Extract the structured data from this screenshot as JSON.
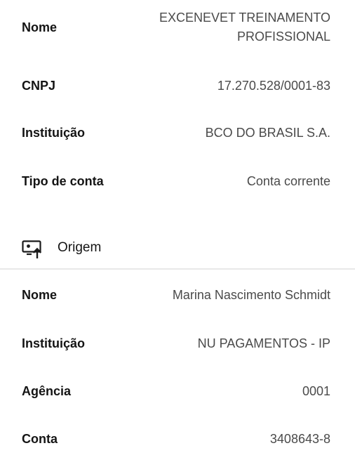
{
  "destino": {
    "rows": [
      {
        "label": "Nome",
        "value": "EXCENEVET TREINAMENTO\nPROFISSIONAL"
      },
      {
        "label": "CNPJ",
        "value": "17.270.528/0001-83"
      },
      {
        "label": "Instituição",
        "value": "BCO DO BRASIL S.A."
      },
      {
        "label": "Tipo de conta",
        "value": "Conta corrente"
      }
    ]
  },
  "origem": {
    "title": "Origem",
    "icon": "screen-upload-icon",
    "rows": [
      {
        "label": "Nome",
        "value": "Marina Nascimento Schmidt"
      },
      {
        "label": "Instituição",
        "value": "NU PAGAMENTOS - IP"
      },
      {
        "label": "Agência",
        "value": "0001"
      },
      {
        "label": "Conta",
        "value": "3408643-8"
      }
    ]
  }
}
